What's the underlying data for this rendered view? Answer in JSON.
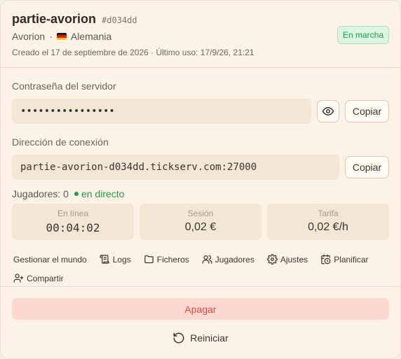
{
  "server": {
    "name": "partie-avorion",
    "id": "#d034dd",
    "game": "Avorion",
    "separator": "·",
    "country": "Alemania",
    "created": "Creado el 17 de septiembre de 2026 · Último uso: 17/9/26, 21:21",
    "status": "En marcha"
  },
  "password": {
    "label": "Contraseña del servidor",
    "value": "••••••••••••••••",
    "copy_label": "Copiar"
  },
  "connection": {
    "label": "Dirección de conexión",
    "value": "partie-avorion-d034dd.tickserv.com:27000",
    "copy_label": "Copiar"
  },
  "players": {
    "label": "Jugadores: 0",
    "live": "en directo"
  },
  "stats": [
    {
      "label": "En línea",
      "value": "00:04:02"
    },
    {
      "label": "Sesión",
      "value": "0,02 €"
    },
    {
      "label": "Tarifa",
      "value": "0,02 €/h"
    }
  ],
  "actions": {
    "manage": "Gestionar el mundo",
    "logs": "Logs",
    "files": "Ficheros",
    "players": "Jugadores",
    "settings": "Ajustes",
    "schedule": "Planificar",
    "share": "Compartir"
  },
  "footer": {
    "stop": "Apagar",
    "restart": "Reiniciar"
  },
  "colors": {
    "background": "#fcf3e6",
    "accent_green": "#1e9b48",
    "danger": "#d94b3f",
    "danger_bg": "#fbd8d2"
  },
  "icons": {
    "eye": "eye-icon",
    "logs": "scroll-icon",
    "files": "folder-icon",
    "players": "users-icon",
    "settings": "gear-icon",
    "schedule": "calendar-clock-icon",
    "share": "user-plus-icon",
    "restart": "rotate-ccw-icon"
  }
}
